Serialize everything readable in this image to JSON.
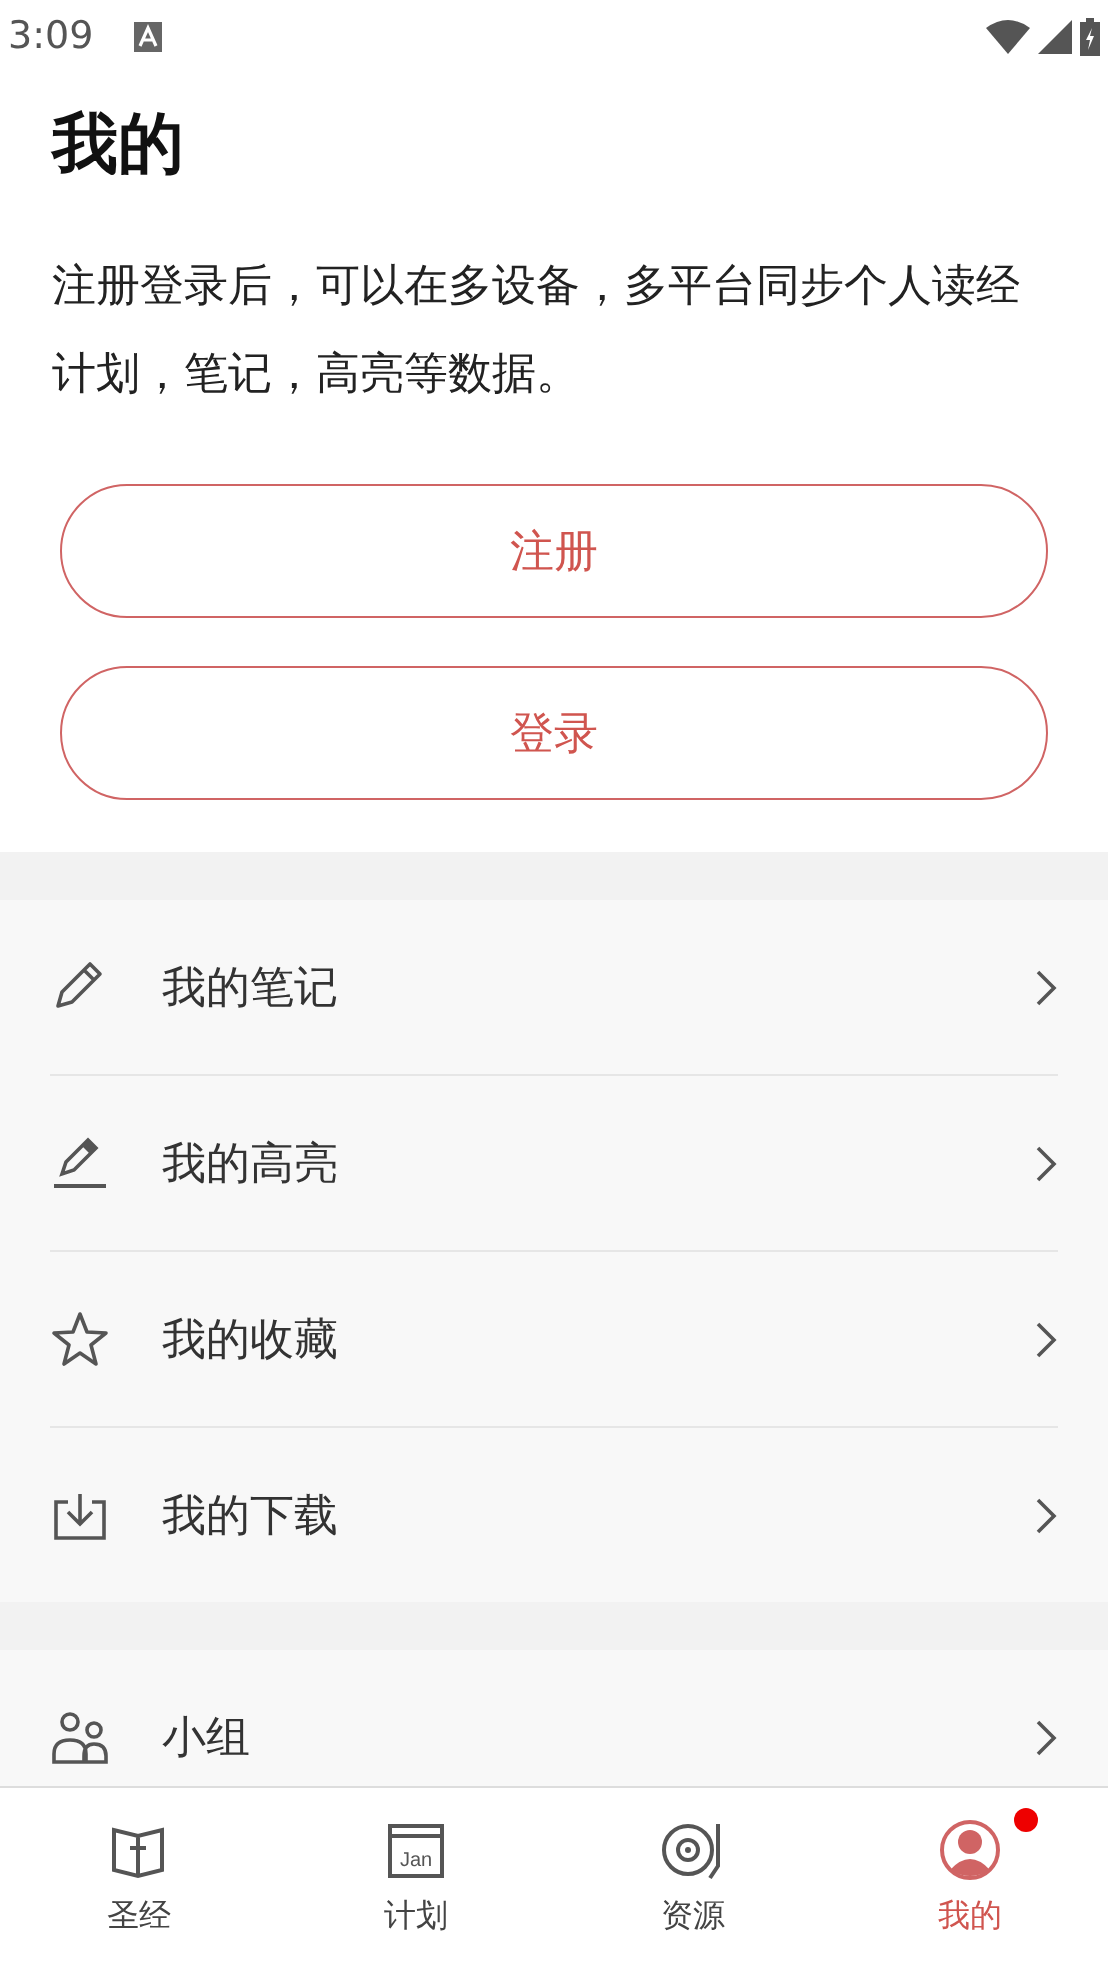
{
  "status_bar": {
    "time": "3:09"
  },
  "title": "我的",
  "description": "注册登录后，可以在多设备，多平台同步个人读经计划，笔记，高亮等数据。",
  "buttons": [
    {
      "label": "注册"
    },
    {
      "label": "登录"
    }
  ],
  "sections": [
    {
      "items": [
        {
          "kind": "note",
          "label": "我的笔记"
        },
        {
          "kind": "highlight",
          "label": "我的高亮"
        },
        {
          "kind": "favorite",
          "label": "我的收藏"
        },
        {
          "kind": "download",
          "label": "我的下载"
        }
      ]
    },
    {
      "items": [
        {
          "kind": "group",
          "label": "小组"
        }
      ]
    }
  ],
  "tabs": [
    {
      "kind": "bible",
      "label": "圣经",
      "selected": false,
      "badge": false
    },
    {
      "kind": "calendar",
      "label": "计划",
      "icon_text": "Jan",
      "selected": false,
      "badge": false
    },
    {
      "kind": "disc",
      "label": "资源",
      "selected": false,
      "badge": false
    },
    {
      "kind": "profile",
      "label": "我的",
      "selected": true,
      "badge": true
    }
  ]
}
